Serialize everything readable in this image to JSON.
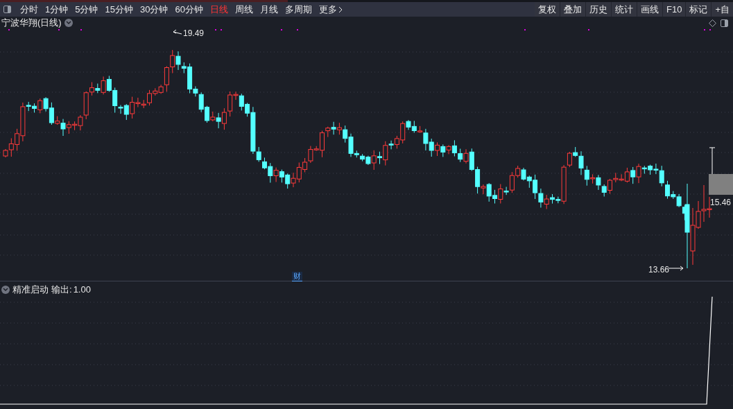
{
  "toolbar": {
    "periods": [
      {
        "label": "分时",
        "selected": false
      },
      {
        "label": "1分钟",
        "selected": false
      },
      {
        "label": "5分钟",
        "selected": false
      },
      {
        "label": "15分钟",
        "selected": false
      },
      {
        "label": "30分钟",
        "selected": false
      },
      {
        "label": "60分钟",
        "selected": false
      },
      {
        "label": "日线",
        "selected": true
      },
      {
        "label": "周线",
        "selected": false
      },
      {
        "label": "月线",
        "selected": false
      },
      {
        "label": "多周期",
        "selected": false
      },
      {
        "label": "更多",
        "selected": false
      }
    ],
    "tools": [
      "复权",
      "叠加",
      "历史",
      "统计",
      "画线",
      "F10",
      "标记",
      "+自"
    ]
  },
  "main_chart": {
    "title": "宁波华翔(日线)",
    "high_label": "19.49",
    "low_label": "13.66",
    "price_label": "15.46",
    "event_badge": "财"
  },
  "indicator": {
    "name": "精准启动",
    "output_label": "输出:",
    "output_value": "1.00"
  }
}
